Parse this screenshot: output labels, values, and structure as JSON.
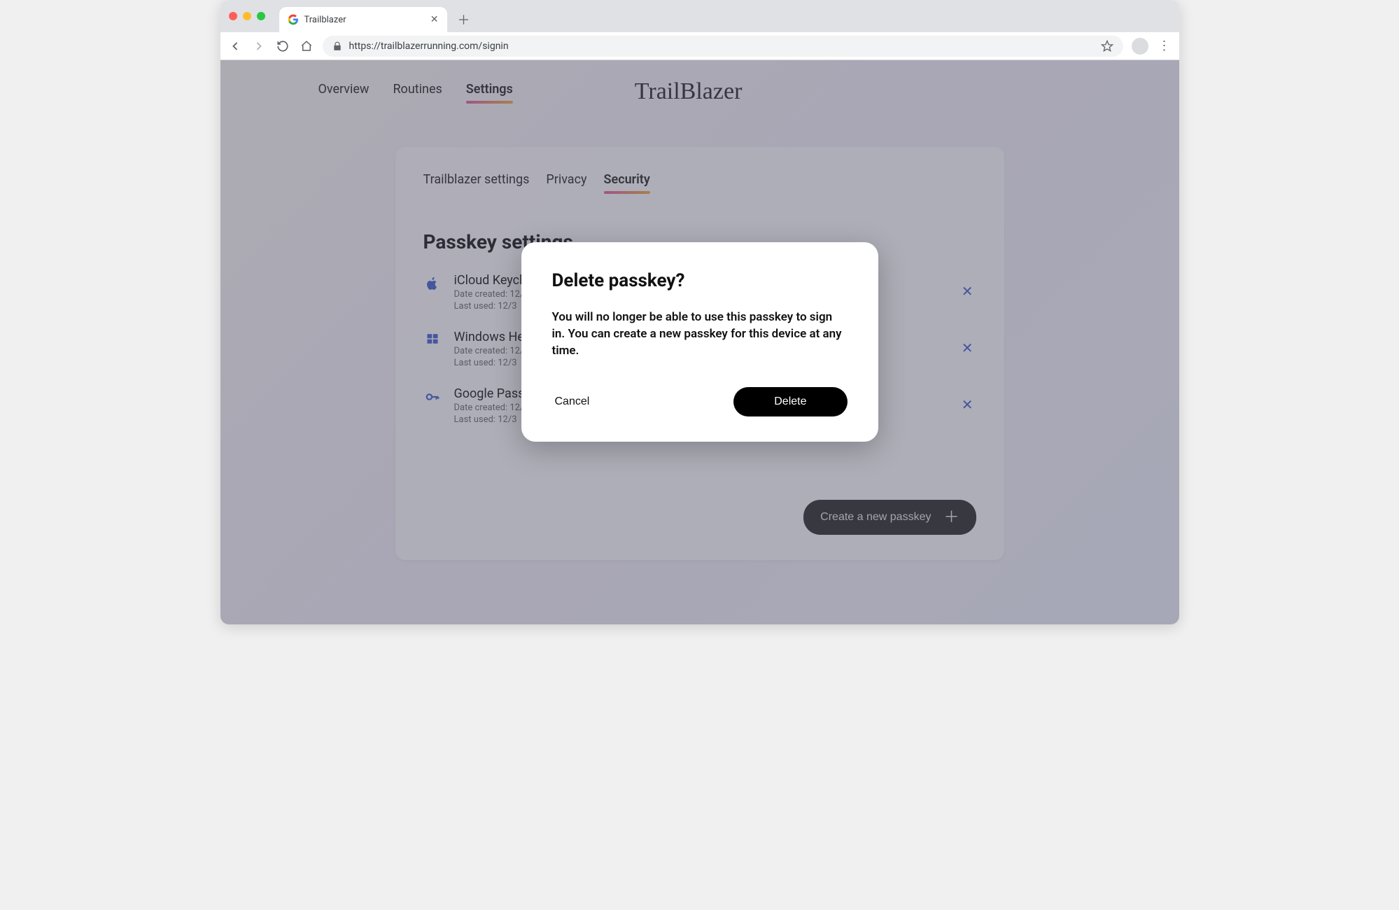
{
  "browser": {
    "tab_title": "Trailblazer",
    "url": "https://trailblazerrunning.com/signin"
  },
  "nav": {
    "items": [
      "Overview",
      "Routines",
      "Settings"
    ],
    "active": "Settings",
    "brand": "TrailBlazer"
  },
  "settings": {
    "tabs": [
      "Trailblazer settings",
      "Privacy",
      "Security"
    ],
    "active_tab": "Security",
    "section_title": "Passkey settings",
    "passkeys": [
      {
        "name": "iCloud Keychain",
        "created_label": "Date created: 12/",
        "used_label": "Last used: 12/3"
      },
      {
        "name": "Windows Hello",
        "created_label": "Date created: 12/",
        "used_label": "Last used: 12/3"
      },
      {
        "name": "Google Password Manager",
        "created_label": "Date created: 12/",
        "used_label": "Last used: 12/3"
      }
    ],
    "create_label": "Create a new passkey"
  },
  "modal": {
    "title": "Delete passkey?",
    "body": "You will no longer be able to use this passkey to sign in. You can create a new passkey for this device at any time.",
    "cancel": "Cancel",
    "confirm": "Delete"
  }
}
